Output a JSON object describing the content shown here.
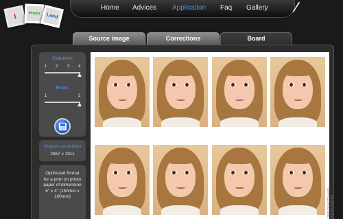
{
  "logo": {
    "letters": [
      "I",
      "Photo",
      "Land"
    ]
  },
  "nav": {
    "items": [
      {
        "label": "Home"
      },
      {
        "label": "Advices"
      },
      {
        "label": "Application"
      },
      {
        "label": "Faq"
      },
      {
        "label": "Gallery"
      }
    ],
    "active_index": 2,
    "active_color": "#5c8fd6"
  },
  "tabs": [
    {
      "label": "Source image"
    },
    {
      "label": "Corrections"
    },
    {
      "label": "Board"
    }
  ],
  "active_tab_index": 2,
  "settings": {
    "columns": {
      "label": "Columns",
      "ticks": [
        "1",
        "2",
        "3",
        "4"
      ],
      "value": 4
    },
    "rows": {
      "label": "Rows",
      "ticks": [
        "1",
        "2"
      ],
      "value": 2
    },
    "save_icon": "floppy-disk-icon"
  },
  "output": {
    "label": "Output resolution",
    "value": "2867 x 1911"
  },
  "info": {
    "text": "Optimized format for a print on photo paper of dimension 6\" x 4\" (150mm x 100mm)"
  },
  "board": {
    "columns": 4,
    "rows": 2
  },
  "copyright": "© 2008 IDPHOTOLAND - Tous droits réservés",
  "colors": {
    "accent_blue": "#4f7fd0",
    "background": "#1a1a1a",
    "panel": "#2d2d2d"
  }
}
